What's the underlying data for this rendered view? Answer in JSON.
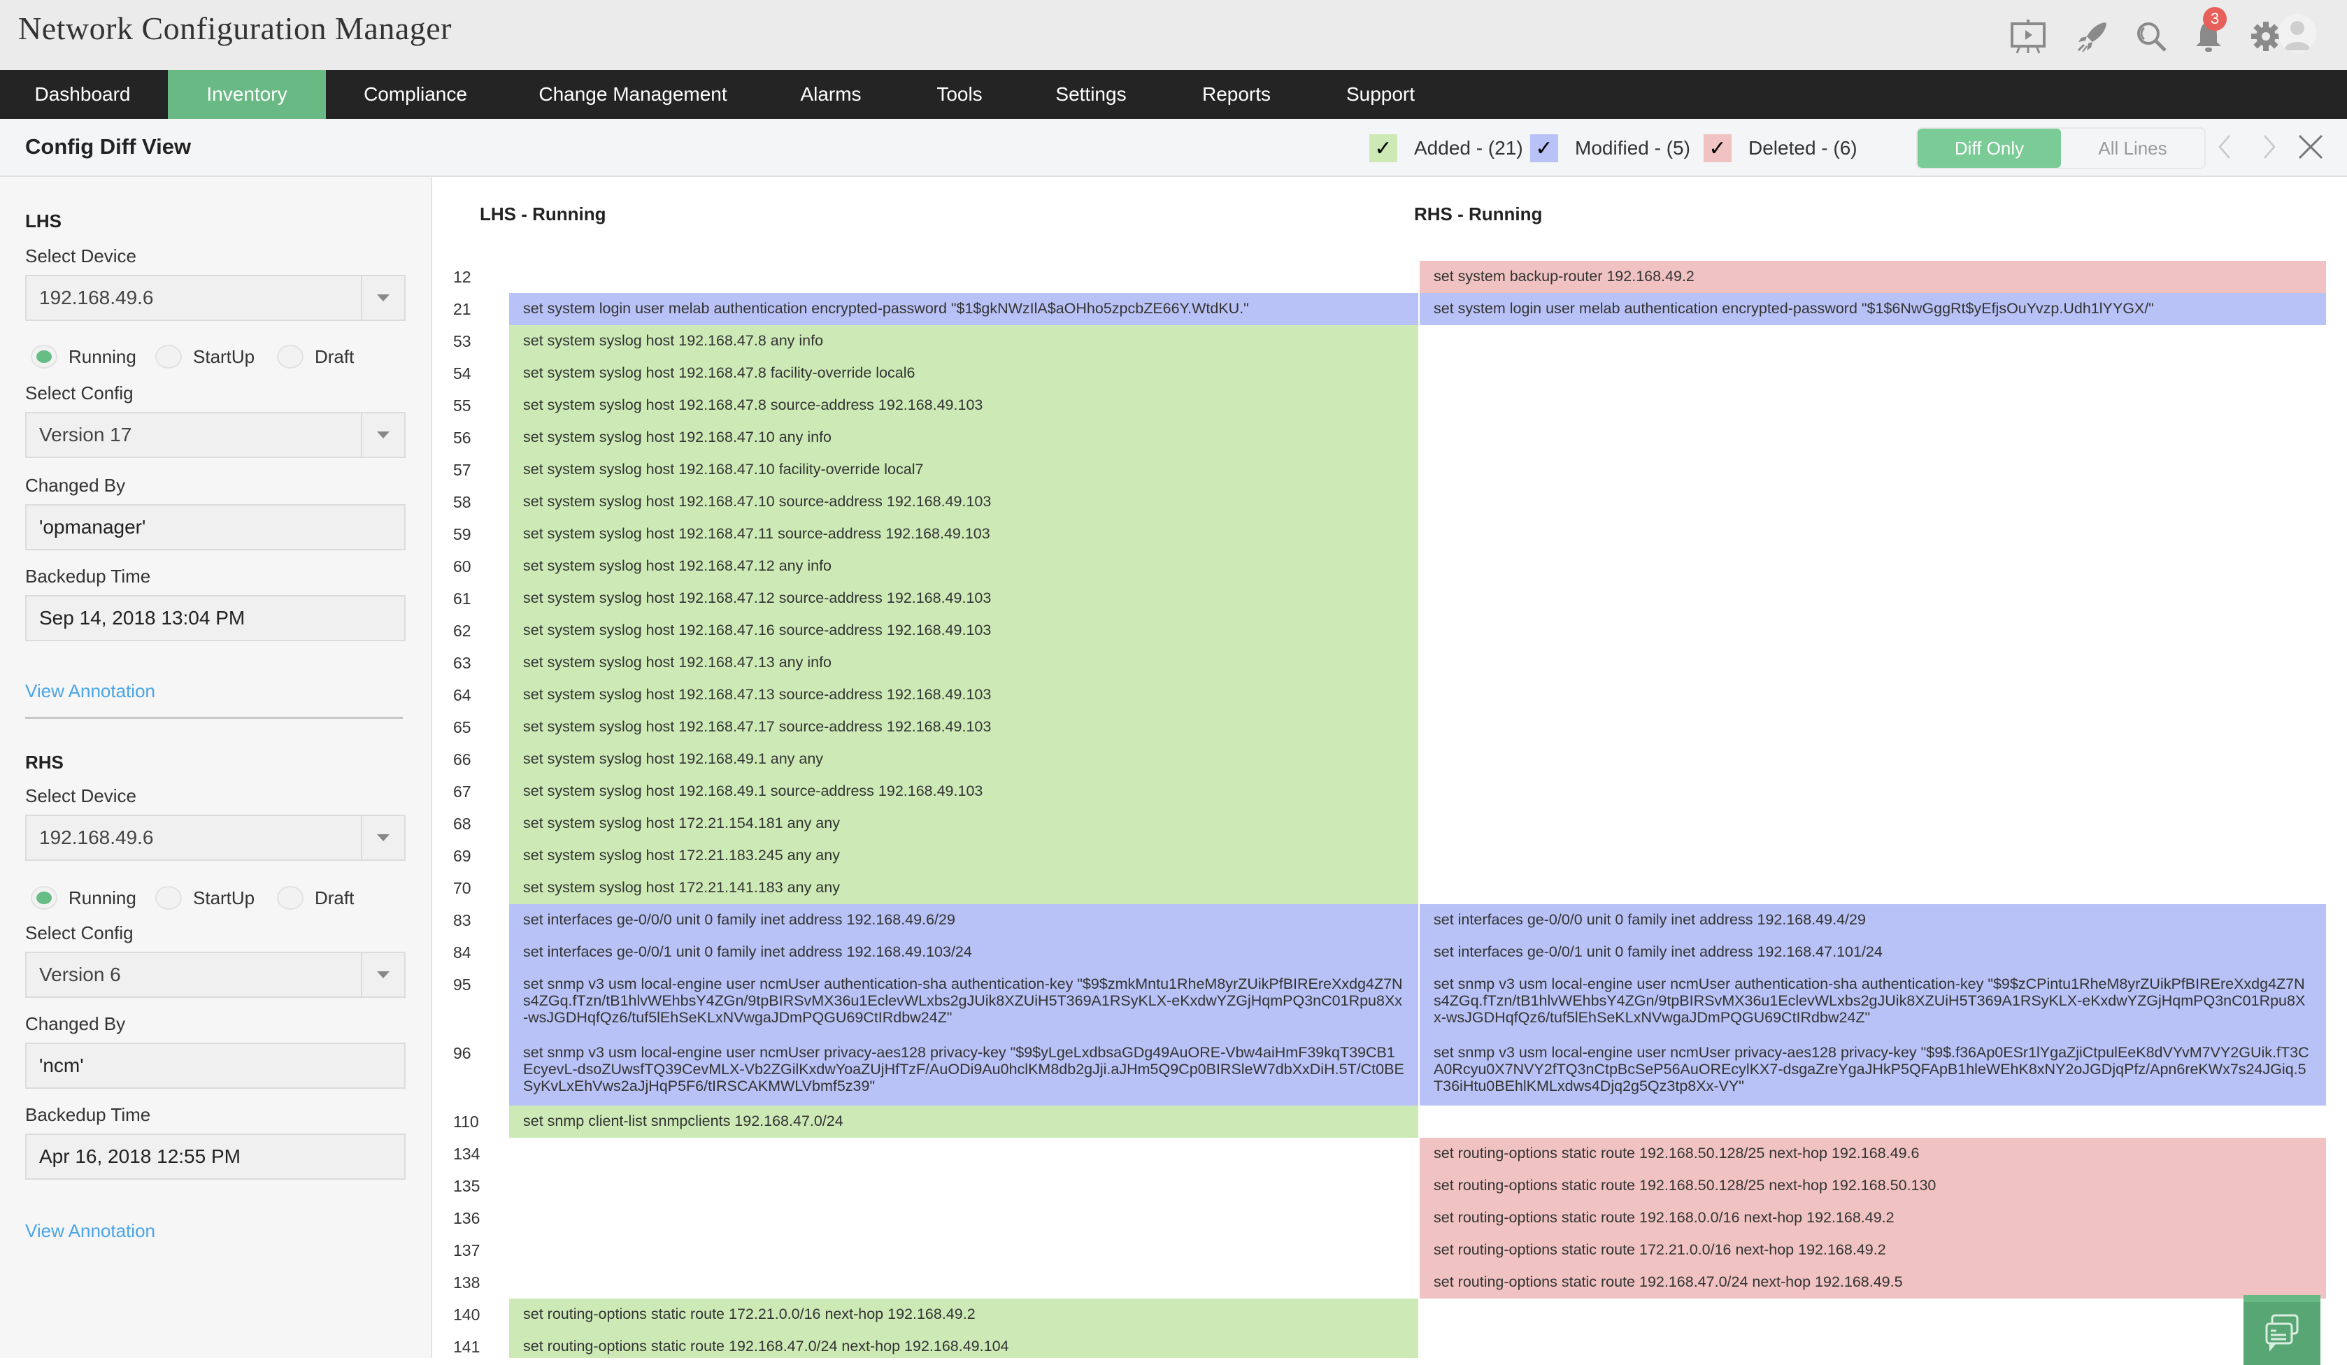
{
  "header": {
    "app_title": "Network Configuration Manager",
    "icons": [
      "presentation-icon",
      "rocket-icon",
      "search-icon",
      "bell-icon",
      "gear-icon",
      "user-avatar-icon"
    ],
    "notification_count": "3"
  },
  "nav": {
    "items": [
      {
        "label": "Dashboard"
      },
      {
        "label": "Inventory",
        "active": true
      },
      {
        "label": "Compliance"
      },
      {
        "label": "Change Management"
      },
      {
        "label": "Alarms"
      },
      {
        "label": "Tools"
      },
      {
        "label": "Settings"
      },
      {
        "label": "Reports"
      },
      {
        "label": "Support"
      }
    ]
  },
  "subheader": {
    "title": "Config Diff View",
    "legend": {
      "added": {
        "label": "Added - (21)",
        "checked": true,
        "color": "#cdeab6"
      },
      "modified": {
        "label": "Modified - (5)",
        "checked": true,
        "color": "#b9c2f6"
      },
      "deleted": {
        "label": "Deleted - (6)",
        "checked": true,
        "color": "#f0c2c2"
      }
    },
    "view_toggle": {
      "diff_only": "Diff Only",
      "all_lines": "All Lines",
      "selected": "Diff Only"
    }
  },
  "sidebar": {
    "lhs": {
      "title": "LHS",
      "device_label": "Select Device",
      "device_value": "192.168.49.6",
      "radios": [
        "Running",
        "StartUp",
        "Draft"
      ],
      "selected_radio": "Running",
      "config_label": "Select Config",
      "config_value": "Version 17",
      "changed_by_label": "Changed By",
      "changed_by_value": "'opmanager'",
      "backup_label": "Backedup Time",
      "backup_value": "Sep 14, 2018 13:04 PM",
      "annotation_link": "View Annotation"
    },
    "rhs": {
      "title": "RHS",
      "device_label": "Select Device",
      "device_value": "192.168.49.6",
      "radios": [
        "Running",
        "StartUp",
        "Draft"
      ],
      "selected_radio": "Running",
      "config_label": "Select Config",
      "config_value": "Version 6",
      "changed_by_label": "Changed By",
      "changed_by_value": "'ncm'",
      "backup_label": "Backedup Time",
      "backup_value": "Apr 16, 2018 12:55 PM",
      "annotation_link": "View Annotation"
    }
  },
  "diff": {
    "lhs_header": "LHS - Running",
    "rhs_header": "RHS - Running",
    "rows": [
      {
        "line": "12",
        "type": "deleted",
        "lhs": "",
        "rhs": "set system backup-router 192.168.49.2"
      },
      {
        "line": "21",
        "type": "modified",
        "lhs": "set system login user melab authentication encrypted-password \"$1$gkNWzIlA$aOHho5zpcbZE66Y.WtdKU.\"",
        "rhs": "set system login user melab authentication encrypted-password \"$1$6NwGggRt$yEfjsOuYvzp.Udh1lYYGX/\""
      },
      {
        "line": "53",
        "type": "added",
        "lhs": "set system syslog host 192.168.47.8 any info",
        "rhs": ""
      },
      {
        "line": "54",
        "type": "added",
        "lhs": "set system syslog host 192.168.47.8 facility-override local6",
        "rhs": ""
      },
      {
        "line": "55",
        "type": "added",
        "lhs": "set system syslog host 192.168.47.8 source-address 192.168.49.103",
        "rhs": ""
      },
      {
        "line": "56",
        "type": "added",
        "lhs": "set system syslog host 192.168.47.10 any info",
        "rhs": ""
      },
      {
        "line": "57",
        "type": "added",
        "lhs": "set system syslog host 192.168.47.10 facility-override local7",
        "rhs": ""
      },
      {
        "line": "58",
        "type": "added",
        "lhs": "set system syslog host 192.168.47.10 source-address 192.168.49.103",
        "rhs": ""
      },
      {
        "line": "59",
        "type": "added",
        "lhs": "set system syslog host 192.168.47.11 source-address 192.168.49.103",
        "rhs": ""
      },
      {
        "line": "60",
        "type": "added",
        "lhs": "set system syslog host 192.168.47.12 any info",
        "rhs": ""
      },
      {
        "line": "61",
        "type": "added",
        "lhs": "set system syslog host 192.168.47.12 source-address 192.168.49.103",
        "rhs": ""
      },
      {
        "line": "62",
        "type": "added",
        "lhs": "set system syslog host 192.168.47.16 source-address 192.168.49.103",
        "rhs": ""
      },
      {
        "line": "63",
        "type": "added",
        "lhs": "set system syslog host 192.168.47.13 any info",
        "rhs": ""
      },
      {
        "line": "64",
        "type": "added",
        "lhs": "set system syslog host 192.168.47.13 source-address 192.168.49.103",
        "rhs": ""
      },
      {
        "line": "65",
        "type": "added",
        "lhs": "set system syslog host 192.168.47.17 source-address 192.168.49.103",
        "rhs": ""
      },
      {
        "line": "66",
        "type": "added",
        "lhs": "set system syslog host 192.168.49.1 any any",
        "rhs": ""
      },
      {
        "line": "67",
        "type": "added",
        "lhs": "set system syslog host 192.168.49.1 source-address 192.168.49.103",
        "rhs": ""
      },
      {
        "line": "68",
        "type": "added",
        "lhs": "set system syslog host 172.21.154.181 any any",
        "rhs": ""
      },
      {
        "line": "69",
        "type": "added",
        "lhs": "set system syslog host 172.21.183.245 any any",
        "rhs": ""
      },
      {
        "line": "70",
        "type": "added",
        "lhs": "set system syslog host 172.21.141.183 any any",
        "rhs": ""
      },
      {
        "line": "83",
        "type": "modified",
        "lhs": "set interfaces ge-0/0/0 unit 0 family inet address 192.168.49.6/29",
        "rhs": "set interfaces ge-0/0/0 unit 0 family inet address 192.168.49.4/29"
      },
      {
        "line": "84",
        "type": "modified",
        "lhs": "set interfaces ge-0/0/1 unit 0 family inet address 192.168.49.103/24",
        "rhs": "set interfaces ge-0/0/1 unit 0 family inet address 192.168.47.101/24"
      },
      {
        "line": "95",
        "type": "modified",
        "lines": 3,
        "lhs": "set snmp v3 usm local-engine user ncmUser authentication-sha authentication-key \"$9$zmkMntu1RheM8yrZUikPfBIRErеXxdg4Z7Ns4ZGq.fTzn/tB1hlvWEhbsY4ZGn/9tpBIRSvMX36u1EclevWLxbs2gJUik8XZUiH5T369A1RSyKLX-eKxdwYZGjHqmPQ3nC01Rpu8Xx-wsJGDHqfQz6/tuf5lEhSeKLxNVwgaJDmPQGU69CtIRdbw24Z\"",
        "rhs": "set snmp v3 usm local-engine user ncmUser authentication-sha authentication-key \"$9$zCPintu1RheM8yrZUikPfBIREreXxdg4Z7Ns4ZGq.fTzn/tB1hlvWEhbsY4ZGn/9tpBIRSvMX36u1EclevWLxbs2gJUik8XZUiH5T369A1RSyKLX-eKxdwYZGjHqmPQ3nC01Rpu8Xx-wsJGDHqfQz6/tuf5lEhSeKLxNVwgaJDmPQGU69CtIRdbw24Z\""
      },
      {
        "line": "96",
        "type": "modified",
        "lines": 3,
        "lhs": "set snmp v3 usm local-engine user ncmUser privacy-aes128 privacy-key \"$9$yLgeLxdbsaGDg49AuORE-Vbw4aiHmF39kqT39CB1EcyevL-dsoZUwsfTQ39CevMLX-Vb2ZGilKxdwYoaZUjHfTzF/AuODi9Au0hclKM8db2gJji.aJHm5Q9Cp0BIRSleW7dbXxDiH.5T/Ct0BESyKvLxEhVws2aJjHqP5F6/tIRSCAKMWLVbmf5z39\"",
        "rhs": "set snmp v3 usm local-engine user ncmUser privacy-aes128 privacy-key \"$9$.f36Ap0ESr1lYgaZjiCtpulEeK8dVYvM7VY2GUik.fT3CA0Rcyu0X7NVY2fTQ3nCtpBcSeP56AuOREcylKX7-dsgaZreYgaJHkP5QFApB1hleWEhK8xNY2oJGDjqPfz/Apn6reKWx7s24JGiq.5T36iHtu0BEhlKMLxdws4Djq2g5Qz3tp8Xx-VY\""
      },
      {
        "line": "110",
        "type": "added",
        "lhs": "set snmp client-list snmpclients 192.168.47.0/24",
        "rhs": ""
      },
      {
        "line": "134",
        "type": "deleted",
        "lhs": "",
        "rhs": "set routing-options static route 192.168.50.128/25 next-hop 192.168.49.6"
      },
      {
        "line": "135",
        "type": "deleted",
        "lhs": "",
        "rhs": "set routing-options static route 192.168.50.128/25 next-hop 192.168.50.130"
      },
      {
        "line": "136",
        "type": "deleted",
        "lhs": "",
        "rhs": "set routing-options static route 192.168.0.0/16 next-hop 192.168.49.2"
      },
      {
        "line": "137",
        "type": "deleted",
        "lhs": "",
        "rhs": "set routing-options static route 172.21.0.0/16 next-hop 192.168.49.2"
      },
      {
        "line": "138",
        "type": "deleted",
        "lhs": "",
        "rhs": "set routing-options static route 192.168.47.0/24 next-hop 192.168.49.5"
      },
      {
        "line": "140",
        "type": "added",
        "lhs": "set routing-options static route 172.21.0.0/16 next-hop 192.168.49.2",
        "rhs": ""
      },
      {
        "line": "141",
        "type": "added",
        "lhs": "set routing-options static route 192.168.47.0/24 next-hop 192.168.49.104",
        "rhs": ""
      }
    ]
  },
  "chat_button": {
    "icon": "chat-icon"
  }
}
